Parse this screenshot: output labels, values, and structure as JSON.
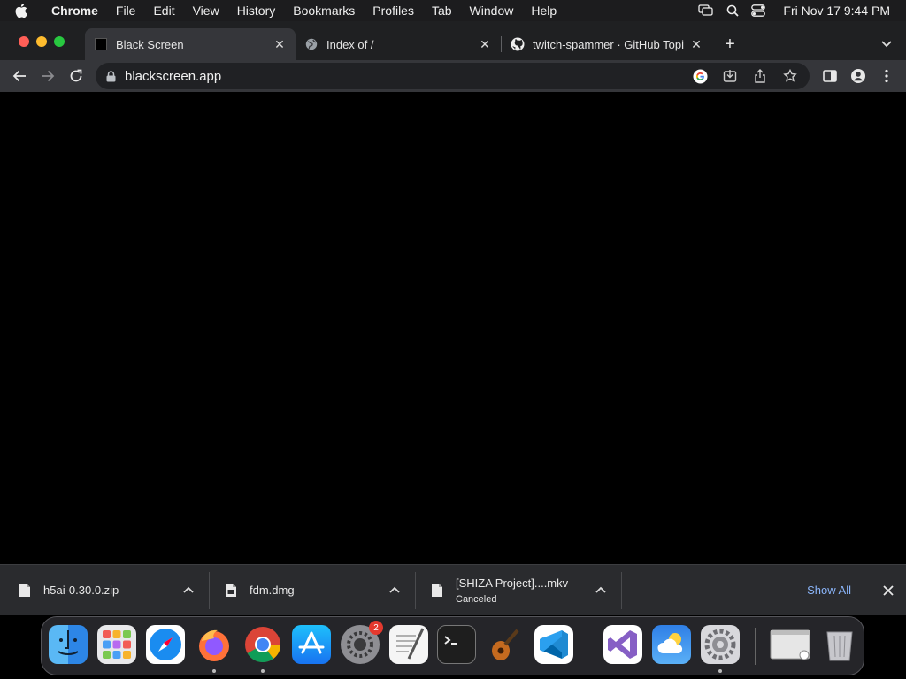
{
  "menubar": {
    "app": "Chrome",
    "items": [
      "File",
      "Edit",
      "View",
      "History",
      "Bookmarks",
      "Profiles",
      "Tab",
      "Window",
      "Help"
    ],
    "clock": "Fri Nov 17  9:44 PM"
  },
  "tabs": [
    {
      "title": "Black Screen",
      "icon": "black-square-favicon"
    },
    {
      "title": "Index of /",
      "icon": "globe-icon"
    },
    {
      "title": "twitch-spammer · GitHub Topic",
      "icon": "github-icon"
    }
  ],
  "address": {
    "url": "blackscreen.app"
  },
  "downloads": {
    "items": [
      {
        "name": "h5ai-0.30.0.zip",
        "status": ""
      },
      {
        "name": "fdm.dmg",
        "status": ""
      },
      {
        "name": "[SHIZA Project]....mkv",
        "status": "Canceled"
      }
    ],
    "show_all": "Show All"
  },
  "dock": {
    "apps": [
      "Finder",
      "Launchpad",
      "Safari",
      "Firefox",
      "Google Chrome",
      "App Store",
      "System Preferences",
      "TextEdit",
      "Terminal",
      "GarageBand",
      "Visual Studio Code",
      "Visual Studio",
      "Weather",
      "System Settings",
      "Preview",
      "Trash"
    ],
    "badge": "2"
  },
  "colors": {
    "accent": "#8ab4f8",
    "content_bg": "#000000",
    "toolbar": "#35363a"
  }
}
